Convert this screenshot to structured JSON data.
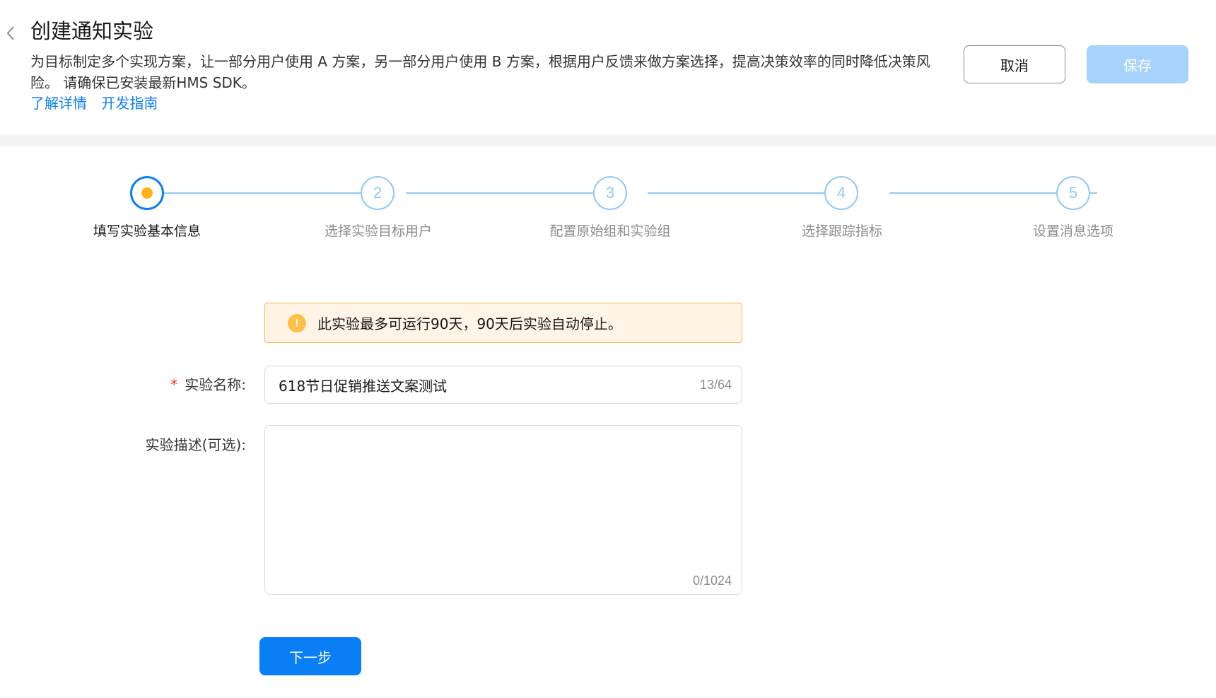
{
  "header": {
    "title": "创建通知实验",
    "description": "为目标制定多个实现方案，让一部分用户使用 A 方案，另一部分用户使用 B 方案，根据用户反馈来做方案选择，提高决策效率的同时降低决策风险。 请确保已安装最新HMS SDK。",
    "links": [
      "了解详情",
      "开发指南"
    ],
    "cancel_label": "取消",
    "save_label": "保存"
  },
  "steps": [
    {
      "number": "1",
      "label": "填写实验基本信息",
      "state": "active"
    },
    {
      "number": "2",
      "label": "选择实验目标用户",
      "state": "pending"
    },
    {
      "number": "3",
      "label": "配置原始组和实验组",
      "state": "pending"
    },
    {
      "number": "4",
      "label": "选择跟踪指标",
      "state": "pending"
    },
    {
      "number": "5",
      "label": "设置消息选项",
      "state": "pending"
    }
  ],
  "notice": {
    "icon": "!",
    "text": "此实验最多可运行90天，90天后实验自动停止。"
  },
  "form": {
    "name_required_mark": "*",
    "name_label": "实验名称:",
    "name_value": "618节日促销推送文案测试",
    "name_counter": "13/64",
    "desc_label": "实验描述(可选):",
    "desc_value": "",
    "desc_counter": "0/1024"
  },
  "footer": {
    "next_label": "下一步"
  },
  "colors": {
    "primary": "#0a7ef5",
    "primary_disabled": "#a6d2fb",
    "step_pending": "#8fc9f8",
    "active_dot": "#ffb31a",
    "warning_bg": "#fff4e6",
    "warning_border": "#ffb44d",
    "required": "#e84026"
  }
}
